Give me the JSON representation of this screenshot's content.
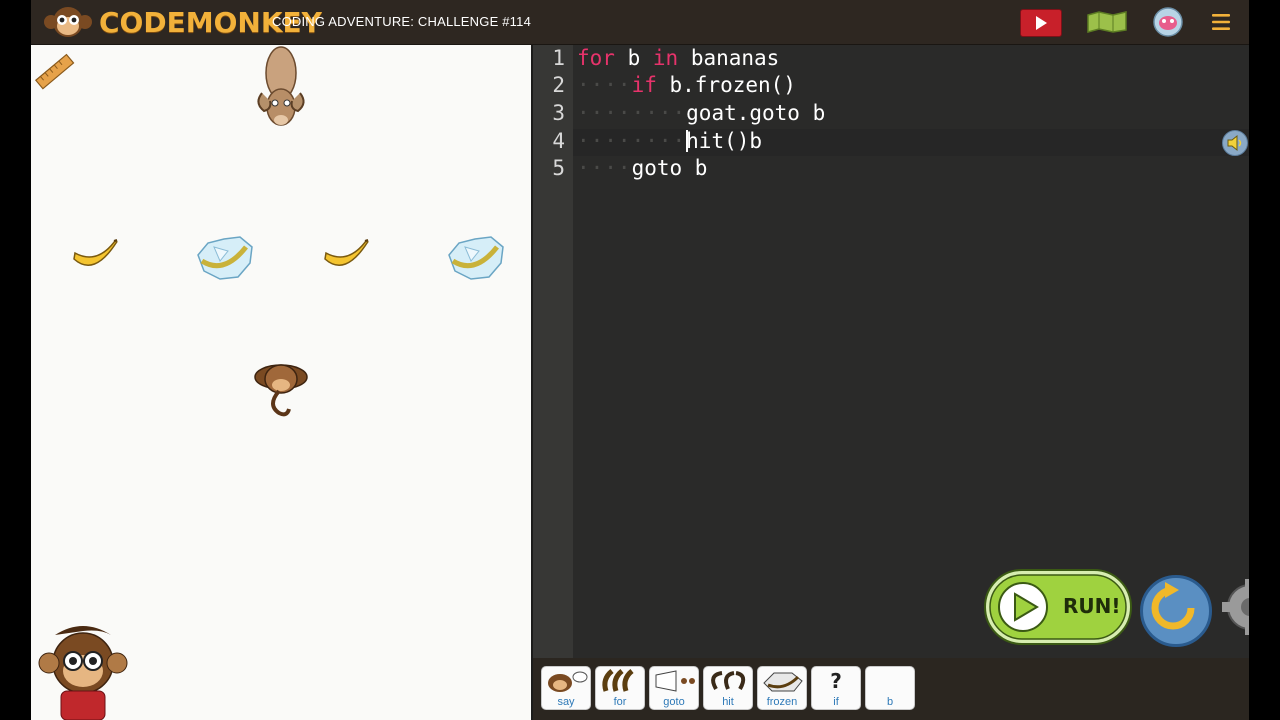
{
  "header": {
    "brand": "CODEMONKEY",
    "challenge_title": "CODING ADVENTURE: CHALLENGE #114",
    "icons": {
      "video": "play-video-icon",
      "map": "map-icon",
      "avatar": "avatar-icon",
      "menu": "hamburger-menu-icon"
    }
  },
  "game": {
    "objects": [
      "ruler-tool",
      "goat",
      "banana",
      "frozen-banana",
      "banana",
      "frozen-banana",
      "monkey",
      "guide-character"
    ]
  },
  "editor": {
    "line_numbers": [
      "1",
      "2",
      "3",
      "4",
      "5"
    ],
    "lines": [
      {
        "indent": "",
        "kw1": "for",
        "text1": " b ",
        "kw2": "in",
        "text2": " bananas"
      },
      {
        "indent": "····",
        "kw1": "if",
        "text1": " b.frozen()",
        "kw2": "",
        "text2": ""
      },
      {
        "indent": "········",
        "kw1": "",
        "text1": "goat.goto b",
        "kw2": "",
        "text2": ""
      },
      {
        "indent": "········",
        "kw1": "",
        "text1": "hit()b",
        "kw2": "",
        "text2": ""
      },
      {
        "indent": "····",
        "kw1": "",
        "text1": "goto b",
        "kw2": "",
        "text2": ""
      }
    ]
  },
  "toolbar": {
    "tools": [
      {
        "label": "say",
        "icon": "monkey-speech-icon"
      },
      {
        "label": "for",
        "icon": "bananas-icon"
      },
      {
        "label": "goto",
        "icon": "goto-arrow-icon"
      },
      {
        "label": "hit",
        "icon": "hit-icon"
      },
      {
        "label": "frozen",
        "icon": "frozen-banana-icon"
      },
      {
        "label": "if",
        "icon": "question-mark-icon",
        "glyph": "?"
      },
      {
        "label": "b",
        "icon": "variable-icon"
      }
    ]
  },
  "controls": {
    "run_label": "RUN!",
    "reset_icon": "reset-arrow-icon",
    "settings_icon": "gear-icon"
  },
  "colors": {
    "keyword": "#e7336b",
    "run_green": "#9fd23f",
    "brand_orange": "#f2b13a"
  }
}
